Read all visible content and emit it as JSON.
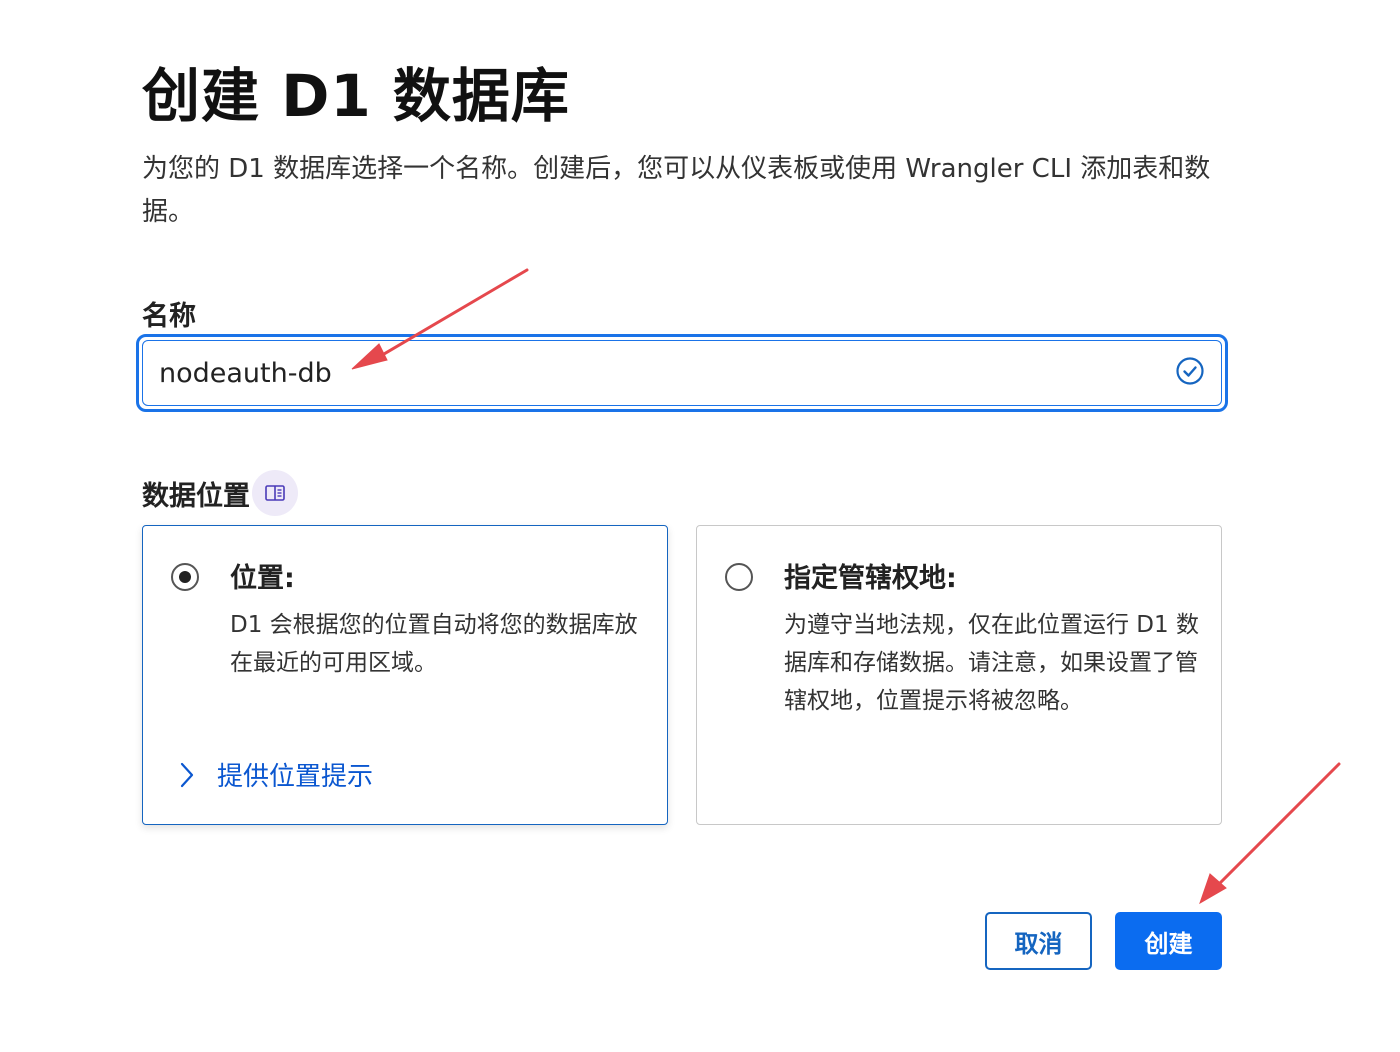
{
  "page": {
    "title": "创建 D1 数据库",
    "description": "为您的 D1 数据库选择一个名称。创建后，您可以从仪表板或使用 Wrangler CLI 添加表和数据。"
  },
  "name_field": {
    "label": "名称",
    "value": "nodeauth-db",
    "valid": true
  },
  "location": {
    "label": "数据位置",
    "options": [
      {
        "title": "位置:",
        "description": "D1 会根据您的位置自动将您的数据库放在最近的可用区域。",
        "selected": true,
        "hint_link": "提供位置提示"
      },
      {
        "title": "指定管辖权地:",
        "description": "为遵守当地法规，仅在此位置运行 D1 数据库和存储数据。请注意，如果设置了管辖权地，位置提示将被忽略。",
        "selected": false
      }
    ]
  },
  "actions": {
    "cancel_label": "取消",
    "create_label": "创建"
  },
  "colors": {
    "primary": "#0b6cf0",
    "focus_border": "#1a73e8",
    "annotation_arrow": "#e5484d"
  },
  "icons": [
    "check-circle-icon",
    "documentation-icon",
    "chevron-right-icon"
  ]
}
